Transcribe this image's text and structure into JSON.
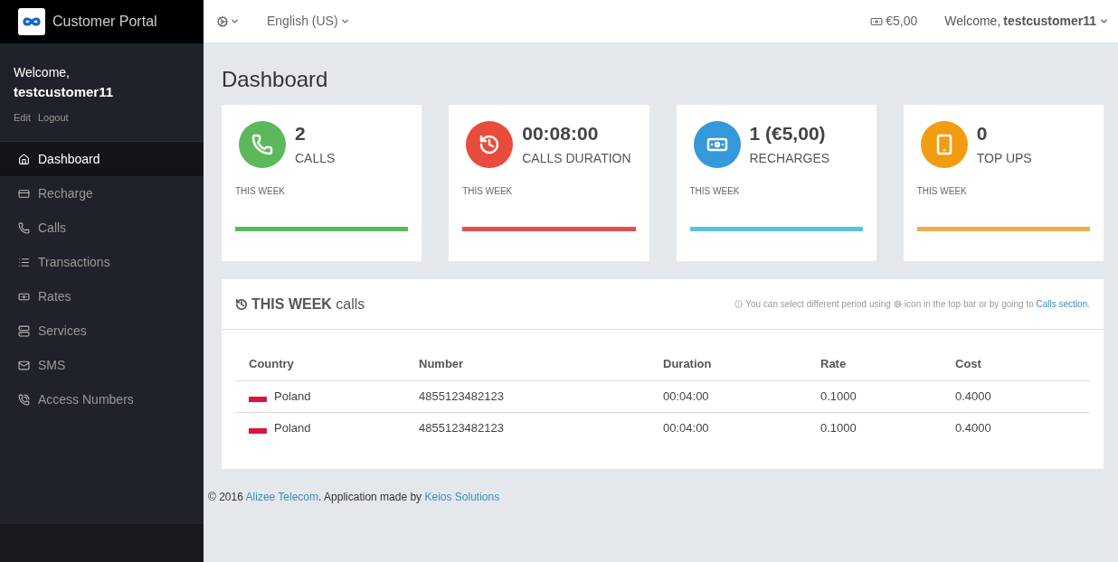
{
  "brand": {
    "title": "Customer Portal"
  },
  "topbar": {
    "language": "English (US)",
    "balance": "€5,00",
    "welcome_prefix": "Welcome,",
    "username": "testcustomer11"
  },
  "sidebar": {
    "welcome": "Welcome,",
    "username": "testcustomer11",
    "links": [
      "Edit",
      "Logout"
    ],
    "items": [
      {
        "label": "Dashboard",
        "selected": true
      },
      {
        "label": "Recharge",
        "selected": false
      },
      {
        "label": "Calls",
        "selected": false
      },
      {
        "label": "Transactions",
        "selected": false
      },
      {
        "label": "Rates",
        "selected": false
      },
      {
        "label": "Services",
        "selected": false
      },
      {
        "label": "SMS",
        "selected": false
      },
      {
        "label": "Access Numbers",
        "selected": false
      }
    ]
  },
  "page_title": "Dashboard",
  "stats": [
    {
      "value": "2",
      "label": "CALLS",
      "period": "THIS WEEK",
      "color": "#5cb85c",
      "level": 1
    },
    {
      "value": "00:08:00",
      "label": "CALLS DURATION",
      "period": "THIS WEEK",
      "color": "#e74c3c",
      "level": 1
    },
    {
      "value": "1 (€5,00)",
      "label": "RECHARGES",
      "period": "THIS WEEK",
      "color": "#3498db",
      "level": 1
    },
    {
      "value": "0",
      "label": "TOP UPS",
      "period": "THIS WEEK",
      "color": "#f39c12",
      "level": 1
    }
  ],
  "calls_panel": {
    "title_bold": "THIS WEEK",
    "title_rest": "calls",
    "info_before": "You can select different period using",
    "info_after": "icon in the top bar or by going to",
    "info_link": "Calls section",
    "info_end": ".",
    "table": {
      "columns": [
        "Country",
        "Number",
        "Duration",
        "Rate",
        "Cost"
      ],
      "rows": [
        [
          "Poland",
          "4855123482123",
          "00:04:00",
          "0.1000",
          "0.4000"
        ],
        [
          "Poland",
          "4855123482123",
          "00:04:00",
          "0.1000",
          "0.4000"
        ]
      ]
    }
  },
  "footer": {
    "before": "© 2016",
    "link1": "Alizee Telecom",
    "middle": ". Application made by",
    "link2": "Keios Solutions"
  }
}
